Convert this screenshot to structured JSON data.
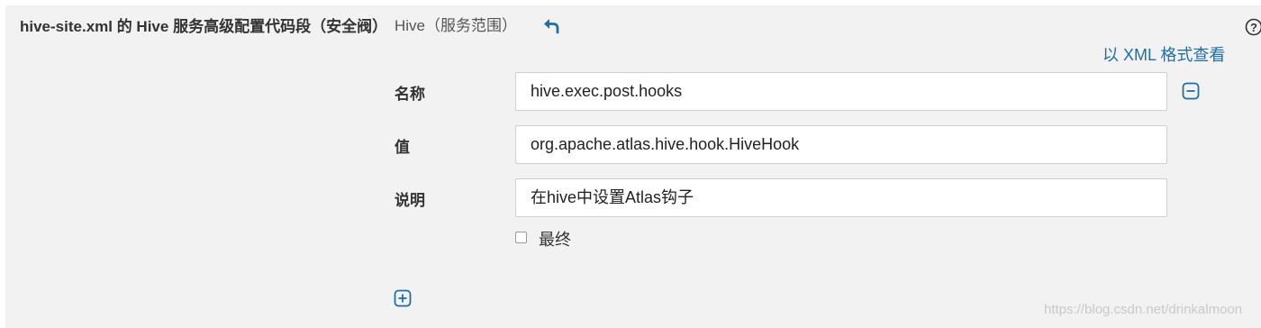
{
  "config": {
    "title": "hive-site.xml 的 Hive 服务高级配置代码段（安全阀）",
    "scope": "Hive（服务范围）",
    "view_xml_link": "以 XML 格式查看"
  },
  "fields": {
    "name_label": "名称",
    "name_value": "hive.exec.post.hooks",
    "value_label": "值",
    "value_value": "org.apache.atlas.hive.hook.HiveHook",
    "description_label": "说明",
    "description_value": "在hive中设置Atlas钩子",
    "final_label": "最终",
    "final_checked": false
  },
  "watermark": "https://blog.csdn.net/drinkalmoon",
  "icons": {
    "undo": "undo-icon",
    "help": "help-icon",
    "remove": "minus-square-icon",
    "add": "plus-square-icon"
  },
  "colors": {
    "accent": "#1f6fa5",
    "panel_bg": "#f2f2f2"
  }
}
